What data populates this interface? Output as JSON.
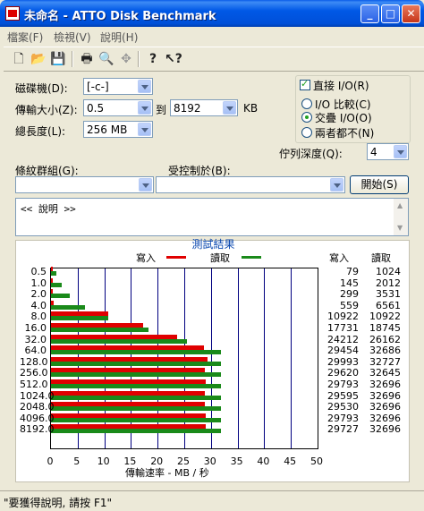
{
  "window": {
    "title": "未命名 - ATTO Disk Benchmark",
    "min": "_",
    "max": "□",
    "close": "✕"
  },
  "menu": [
    "檔案(F)",
    "檢視(V)",
    "說明(H)"
  ],
  "toolbar": {
    "icons": [
      "new-icon",
      "open-icon",
      "save-icon",
      "print-icon",
      "print-preview-icon",
      "move-icon",
      "help-icon",
      "context-help-icon"
    ]
  },
  "form": {
    "drive_label": "磁碟機(D):",
    "drive_value": "[-c-]",
    "transfer_label": "傳輸大小(Z):",
    "transfer_from": "0.5",
    "transfer_to_label": "到",
    "transfer_to": "8192",
    "transfer_unit": "KB",
    "length_label": "總長度(L):",
    "length_value": "256 MB",
    "direct_io_label": "直接 I/O(R)",
    "direct_io_checked": true,
    "io_compare_label": "I/O 比較(C)",
    "io_overlap_label": "交疊 I/O(O)",
    "io_neither_label": "兩者都不(N)",
    "selected_io": "overlap",
    "queue_label": "佇列深度(Q):",
    "queue_value": "4",
    "pattern_label": "條紋群組(G):",
    "pattern_value": "",
    "controlled_label": "受控制於(B):",
    "controlled_value": "",
    "start_button": "開始(S)",
    "description": "<< 說明 >>"
  },
  "results": {
    "title": "測試結果",
    "write_label": "寫入",
    "read_label": "讀取",
    "col_write": "寫入",
    "col_read": "讀取",
    "xlabel": "傳輸速率 - MB / 秒",
    "write_color": "#e00000",
    "read_color": "#1a8a1a"
  },
  "chart_data": {
    "type": "bar",
    "orientation": "horizontal",
    "categories": [
      "0.5",
      "1.0",
      "2.0",
      "4.0",
      "8.0",
      "16.0",
      "32.0",
      "64.0",
      "128.0",
      "256.0",
      "512.0",
      "1024.0",
      "2048.0",
      "4096.0",
      "8192.0"
    ],
    "series": [
      {
        "name": "寫入",
        "values": [
          79,
          145,
          299,
          559,
          10922,
          17731,
          24212,
          29454,
          29993,
          29620,
          29793,
          29595,
          29530,
          29793,
          29727
        ]
      },
      {
        "name": "讀取",
        "values": [
          1024,
          2012,
          3531,
          6561,
          10922,
          18745,
          26162,
          32686,
          32727,
          32645,
          32696,
          32696,
          32696,
          32696,
          32696
        ]
      }
    ],
    "x_ticks": [
      "0",
      "5",
      "10",
      "15",
      "20",
      "25",
      "30",
      "35",
      "40",
      "45",
      "50"
    ],
    "xlim": [
      0,
      50
    ],
    "xlabel": "傳輸速率 - MB / 秒",
    "grid": true
  },
  "status": {
    "text": "\"要獲得說明, 請按 F1\""
  }
}
